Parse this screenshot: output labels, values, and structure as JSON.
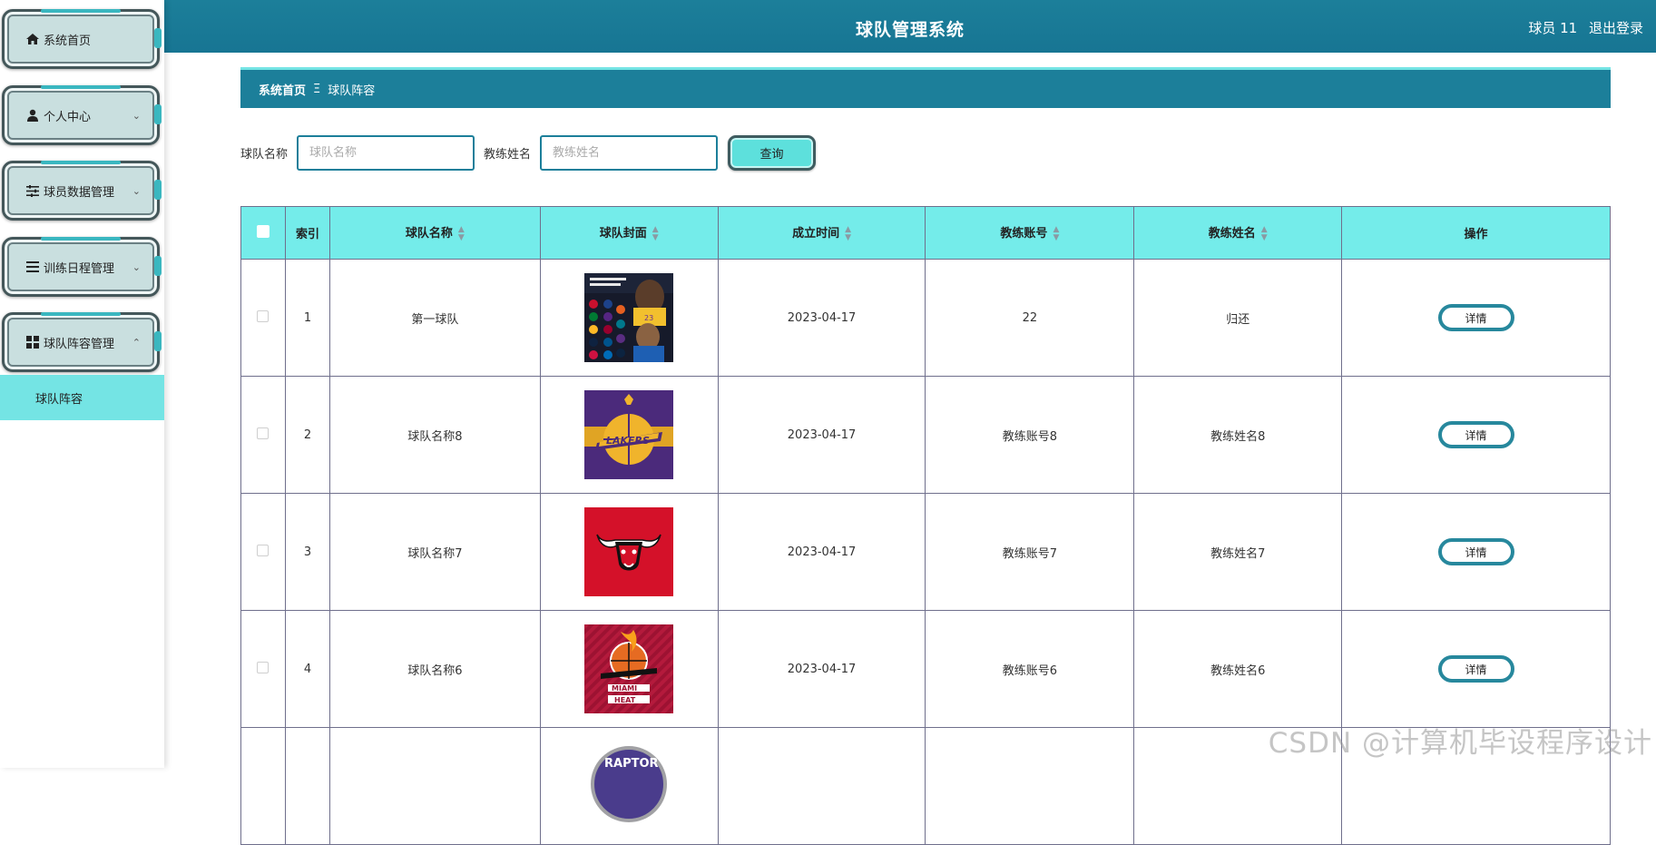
{
  "app": {
    "title": "球队管理系统"
  },
  "header": {
    "user_label": "球员 11",
    "logout_label": "退出登录"
  },
  "sidebar": {
    "items": [
      {
        "label": "系统首页",
        "icon": "home-icon"
      },
      {
        "label": "个人中心",
        "icon": "user-icon",
        "expanded": false
      },
      {
        "label": "球员数据管理",
        "icon": "sliders-icon",
        "expanded": false
      },
      {
        "label": "训练日程管理",
        "icon": "list-icon",
        "expanded": false
      },
      {
        "label": "球队阵容管理",
        "icon": "grid-icon",
        "expanded": true
      }
    ],
    "subitem": {
      "label": "球队阵容",
      "active": true
    }
  },
  "breadcrumb": {
    "home": "系统首页",
    "separator": "Ξ",
    "current": "球队阵容"
  },
  "search": {
    "team_label": "球队名称",
    "team_placeholder": "球队名称",
    "team_value": "",
    "coach_label": "教练姓名",
    "coach_placeholder": "教练姓名",
    "coach_value": "",
    "button": "查询"
  },
  "table": {
    "headers": {
      "index": "索引",
      "team_name": "球队名称",
      "cover": "球队封面",
      "founded": "成立时间",
      "coach_account": "教练账号",
      "coach_name": "教练姓名",
      "actions": "操作"
    },
    "detail_label": "详情",
    "rows": [
      {
        "index": "1",
        "team_name": "第一球队",
        "cover": "poster-cover",
        "founded": "2023-04-17",
        "coach_account": "22",
        "coach_name": "归还"
      },
      {
        "index": "2",
        "team_name": "球队名称8",
        "cover": "lakers-logo",
        "founded": "2023-04-17",
        "coach_account": "教练账号8",
        "coach_name": "教练姓名8"
      },
      {
        "index": "3",
        "team_name": "球队名称7",
        "cover": "bulls-logo",
        "founded": "2023-04-17",
        "coach_account": "教练账号7",
        "coach_name": "教练姓名7"
      },
      {
        "index": "4",
        "team_name": "球队名称6",
        "cover": "heat-logo",
        "founded": "2023-04-17",
        "coach_account": "教练账号6",
        "coach_name": "教练姓名6"
      },
      {
        "index": "",
        "team_name": "",
        "cover": "raptors-logo",
        "founded": "",
        "coach_account": "",
        "coach_name": ""
      }
    ]
  },
  "colors": {
    "primary": "#1c7f9a",
    "accent": "#74e4e4",
    "menu_bg": "#c9dfdf",
    "button_border": "#27889d"
  },
  "watermark": "CSDN @计算机毕设程序设计"
}
